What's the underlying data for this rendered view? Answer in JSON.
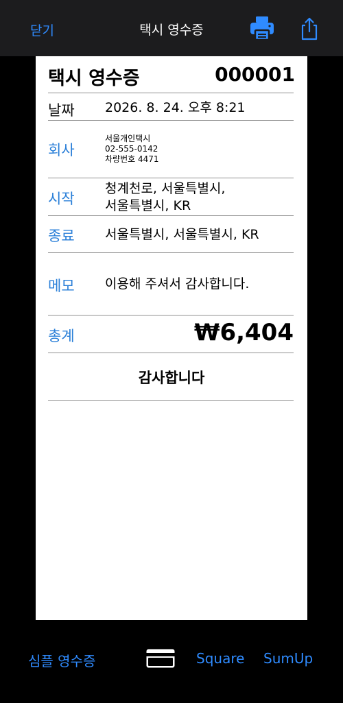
{
  "topbar": {
    "close_label": "닫기",
    "title": "택시 영수증"
  },
  "icons": {
    "printer": "printer-icon",
    "share": "share-icon",
    "card": "credit-card-icon"
  },
  "colors": {
    "accent": "#2f8bff",
    "label_blue": "#2a7fd8",
    "topbar_bg": "#1c1c1e"
  },
  "receipt": {
    "title": "택시 영수증",
    "number": "000001",
    "date": {
      "label": "날짜",
      "value": "2026. 8. 24. 오후 8:21"
    },
    "company": {
      "label": "회사",
      "name": "서울개인택시",
      "phone": "02-555-0142",
      "vehicle": "차량번호 4471"
    },
    "start": {
      "label": "시작",
      "line1": "청계천로, 서울특별시,",
      "line2": "서울특별시, KR"
    },
    "end": {
      "label": "종료",
      "value": "서울특별시, 서울특별시, KR"
    },
    "memo": {
      "label": "메모",
      "value": "이용해 주셔서 감사합니다."
    },
    "total": {
      "label": "총계",
      "value": "₩6,404"
    },
    "thanks": "감사합니다"
  },
  "bottom": {
    "simple_label": "심플 영수증",
    "square_label": "Square",
    "sumup_label": "SumUp"
  }
}
